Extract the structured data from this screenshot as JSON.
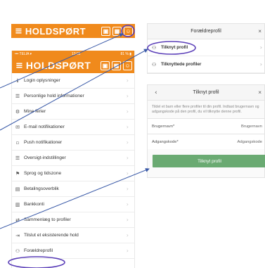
{
  "header": {
    "logo": "HOLDSPØRT",
    "burger": "≡",
    "icons": [
      "▣",
      "▦",
      "☺"
    ]
  },
  "statusbar": {
    "carrier": "••• TELIA ▾",
    "time": "13:02",
    "battery": "81 % ▮"
  },
  "menu": {
    "items": [
      {
        "icon": "ℹ",
        "label": "Login oplysninger"
      },
      {
        "icon": "☰",
        "label": "Personlige hold informationer"
      },
      {
        "icon": "⚙",
        "label": "Mine ferier"
      },
      {
        "icon": "✉",
        "label": "E-mail notifikationer"
      },
      {
        "icon": "▫",
        "label": "Push notifikationer"
      },
      {
        "icon": "☰",
        "label": "Oversigt-indstillinger"
      },
      {
        "icon": "⚑",
        "label": "Sprog og tidszone"
      },
      {
        "icon": "▤",
        "label": "Betalingsoverblik"
      },
      {
        "icon": "▥",
        "label": "Bankkonti"
      },
      {
        "icon": "⇄",
        "label": "Sammenlæg to profiler"
      },
      {
        "icon": "⇥",
        "label": "Tilslut et eksisterende hold"
      },
      {
        "icon": "⚇",
        "label": "Forældreprofil"
      }
    ],
    "chevron": "›"
  },
  "parent_panel": {
    "title": "Forældreprofil",
    "close": "×",
    "rows": [
      {
        "icon": "⚇",
        "label": "Tilknyt profil"
      },
      {
        "icon": "⚇",
        "label": "Tilknyttede profiler"
      }
    ]
  },
  "link_panel": {
    "back": "‹",
    "title": "Tilknyt profil",
    "close": "×",
    "description": "Tildel et barn eller flere profiler til din profil. Indtast brugernavn og adgangskode på den profil, du vil tilknytte denne profil.",
    "fields": [
      {
        "label": "Brugernavn*",
        "placeholder": "Brugernavn"
      },
      {
        "label": "Adgangskode*",
        "placeholder": "Adgangskode"
      }
    ],
    "button": "Tilknyt profil"
  },
  "colors": {
    "brand_orange": "#f08a1c",
    "button_green": "#6aaa72",
    "annotation_blue": "#3a5aa8",
    "highlight_purple": "#5b3fb8"
  }
}
